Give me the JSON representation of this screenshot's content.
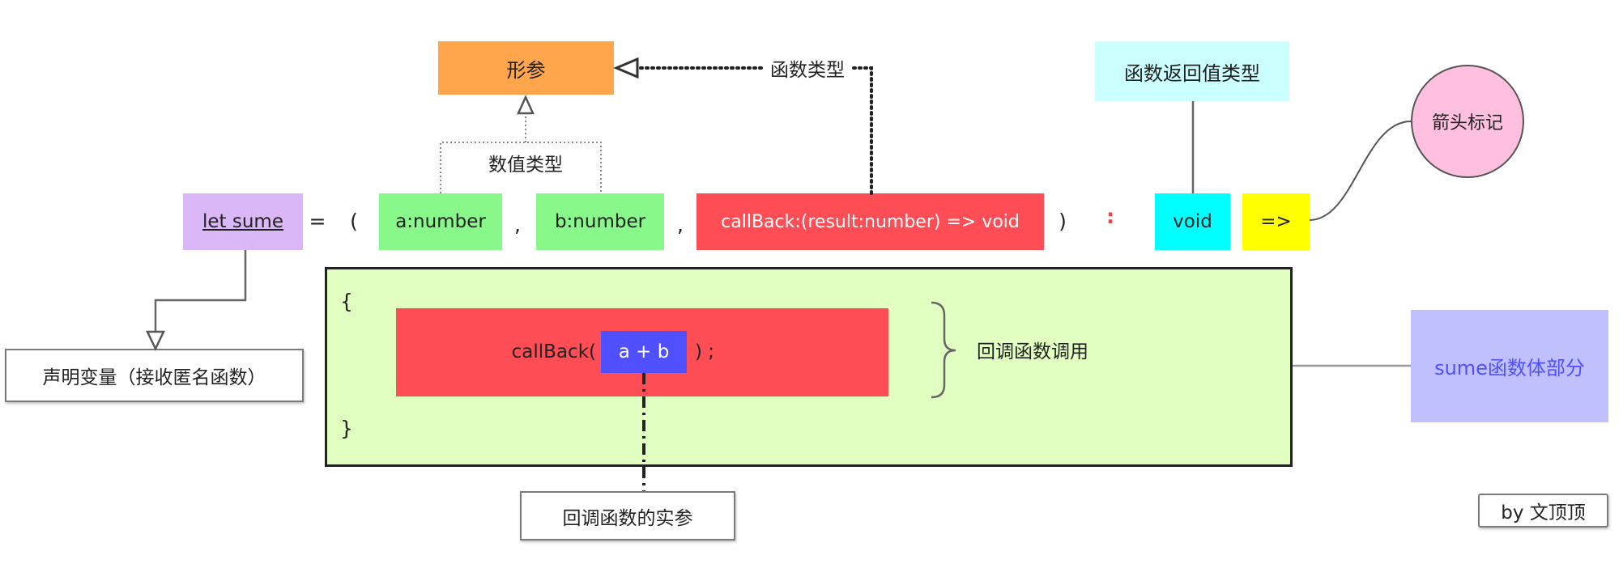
{
  "params_box": "形参",
  "function_type_label": "函数类型",
  "return_type_box": "函数返回值类型",
  "arrow_marker_circle": "箭头标记",
  "number_type_label": "数值类型",
  "signature": {
    "let_sume": "let sume",
    "equals": "=",
    "open_paren": "(",
    "param_a": "a:number",
    "comma_1": ",",
    "param_b": "b:number",
    "comma_2": ",",
    "param_callback": "callBack:(result:number) => void",
    "close_paren": ")",
    "colon": ":",
    "return_void": "void",
    "arrow": "=>"
  },
  "declare_box": "声明变量（接收匿名函数）",
  "body": {
    "open_brace": "{",
    "close_brace": "}",
    "call_prefix": "callBack(",
    "argument": "a + b",
    "call_suffix": ") ;"
  },
  "callback_call_label": "回调函数调用",
  "body_box": "sume函数体部分",
  "actual_arg_box": "回调函数的实参",
  "author": "by 文顶顶",
  "colors": {
    "params": "#ffa64d",
    "return_type": "#ccffff",
    "circle": "#ffc0e0",
    "let_sume": "#dab8f8",
    "number_param": "#88f88a",
    "callback": "#ff4d55",
    "void": "#00ffff",
    "arrow": "#ffff00",
    "body_bg": "#e0ffc0",
    "argument": "#5050ff",
    "body_side": "#c0c0ff",
    "body_side_text": "#5050ff",
    "colon": "#ff3b3b"
  }
}
